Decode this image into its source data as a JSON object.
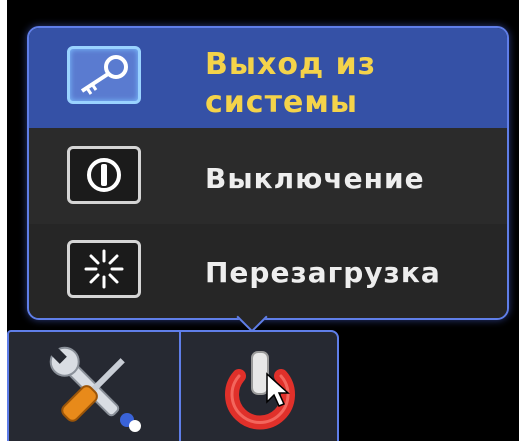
{
  "menu": {
    "items": [
      {
        "label_line1": "Выход из",
        "label_line2": "системы",
        "icon": "key-icon",
        "selected": true
      },
      {
        "label": "Выключение",
        "icon": "power-off-icon"
      },
      {
        "label": "Перезагрузка",
        "icon": "restart-icon"
      }
    ]
  },
  "taskbar": {
    "buttons": [
      {
        "icon": "tools-icon"
      },
      {
        "icon": "power-button-icon",
        "active": true
      }
    ]
  },
  "colors": {
    "accent_border": "#5f7ee8",
    "selected_bg": "#3551a6",
    "selected_text": "#f4d34a",
    "text": "#eeeeee",
    "power_red": "#e0302a"
  }
}
